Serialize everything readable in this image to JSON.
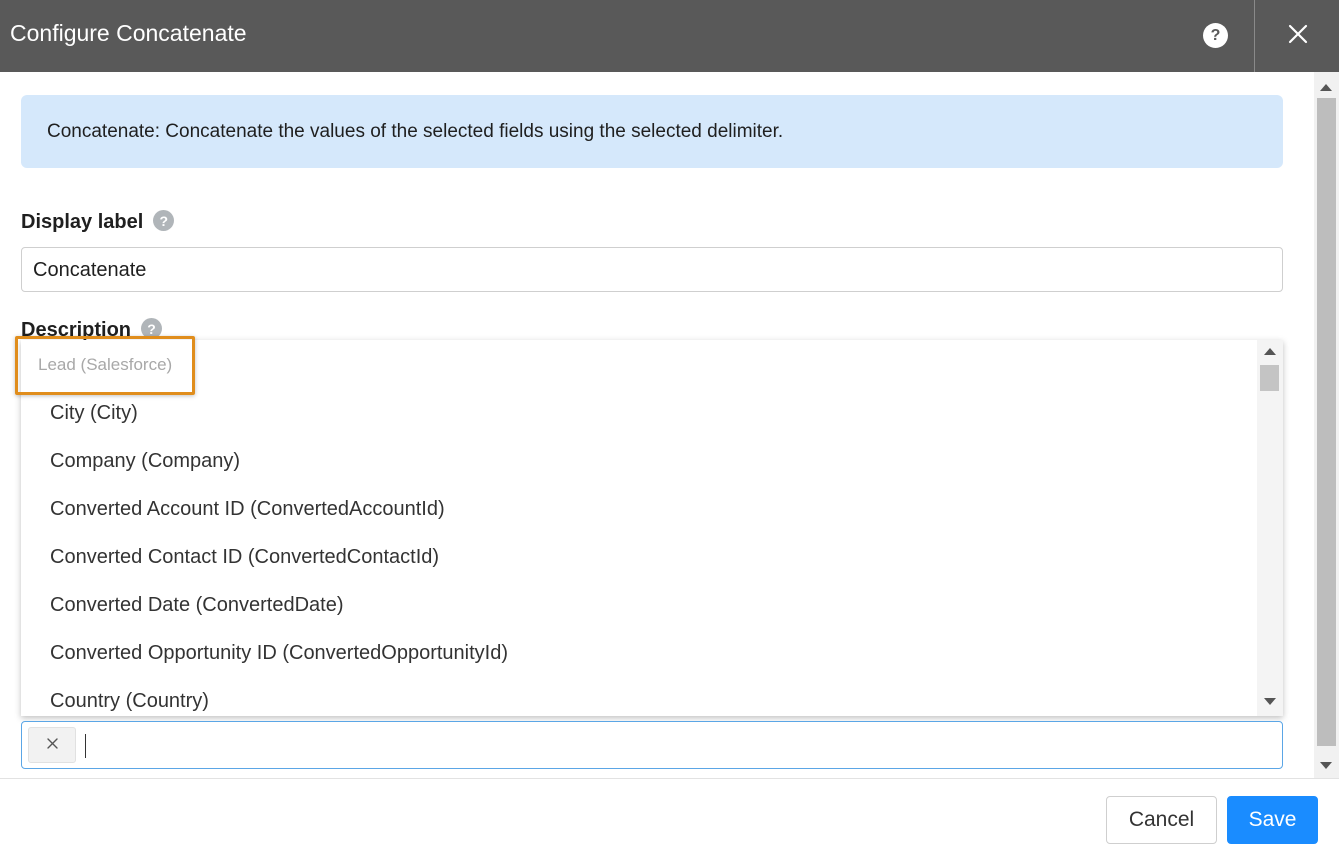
{
  "dialog": {
    "title": "Configure Concatenate",
    "help_icon": "question-circle-icon",
    "help_glyph": "?",
    "close_icon": "close-icon"
  },
  "info": {
    "text": "Concatenate: Concatenate the values of the selected fields using the selected delimiter."
  },
  "display_label": {
    "label": "Display label",
    "help_glyph": "?",
    "value": "Concatenate"
  },
  "description": {
    "label": "Description",
    "help_glyph": "?"
  },
  "dropdown": {
    "group_label": "Lead (Salesforce)",
    "items": [
      "City (City)",
      "Company (Company)",
      "Converted Account ID (ConvertedAccountId)",
      "Converted Contact ID (ConvertedContactId)",
      "Converted Date (ConvertedDate)",
      "Converted Opportunity ID (ConvertedOpportunityId)",
      "Country (Country)"
    ]
  },
  "fields_input": {
    "chip_remove_icon": "remove-chip-icon",
    "value": ""
  },
  "footer": {
    "cancel_label": "Cancel",
    "save_label": "Save"
  },
  "colors": {
    "titlebar": "#595959",
    "info_background": "#d5e8fb",
    "highlight_border": "#e08d1c",
    "primary": "#1a8cff"
  }
}
